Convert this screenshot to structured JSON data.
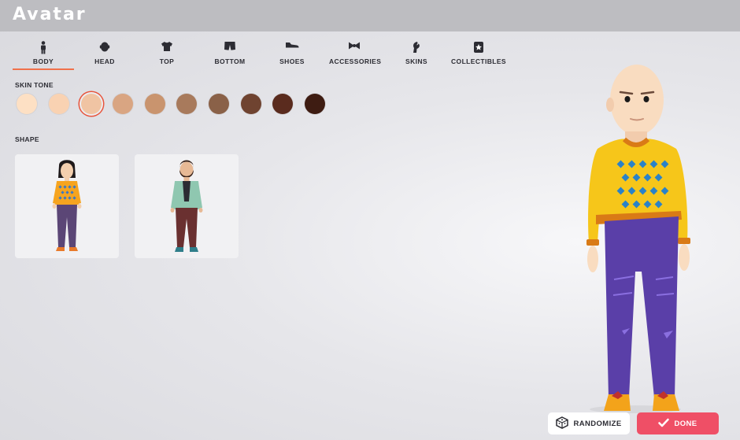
{
  "app": {
    "title": "Avatar"
  },
  "tabs": [
    {
      "label": "BODY",
      "icon": "body-icon",
      "active": true
    },
    {
      "label": "HEAD",
      "icon": "head-icon"
    },
    {
      "label": "TOP",
      "icon": "tshirt-icon"
    },
    {
      "label": "BOTTOM",
      "icon": "shorts-icon"
    },
    {
      "label": "SHOES",
      "icon": "shoe-icon"
    },
    {
      "label": "ACCESSORIES",
      "icon": "bow-icon"
    },
    {
      "label": "SKINS",
      "icon": "skin-icon"
    },
    {
      "label": "COLLECTIBLES",
      "icon": "star-card-icon"
    }
  ],
  "skin_tone": {
    "label": "SKIN TONE",
    "selected_index": 2,
    "colors": [
      "#fde0c4",
      "#f9d2b2",
      "#f0c4a3",
      "#d9a582",
      "#c9946e",
      "#a87a5c",
      "#8a6148",
      "#6f4330",
      "#5a2b1e",
      "#3e1c12"
    ]
  },
  "shape": {
    "label": "SHAPE",
    "options": [
      "feminine-body-preview",
      "masculine-body-preview"
    ]
  },
  "actions": {
    "randomize": "RANDOMIZE",
    "done": "DONE"
  }
}
